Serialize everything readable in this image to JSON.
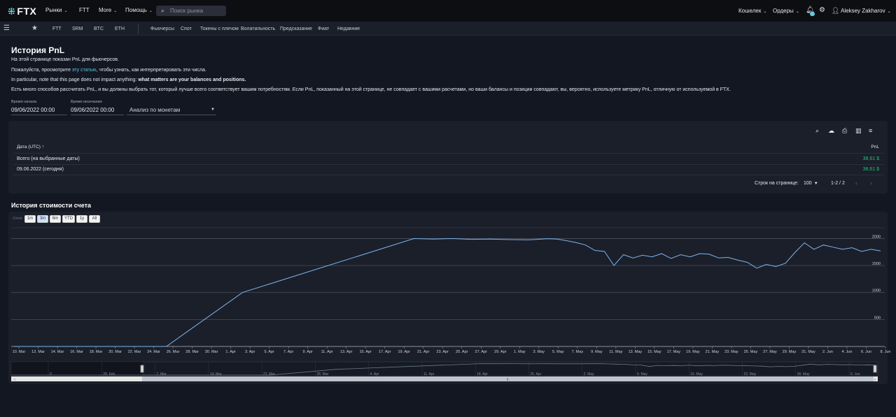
{
  "header": {
    "logo_text": "FTX",
    "nav": [
      {
        "label": "Рынки",
        "dropdown": true
      },
      {
        "label": "FTT",
        "dropdown": false
      },
      {
        "label": "More",
        "dropdown": true
      },
      {
        "label": "Помощь",
        "dropdown": true
      }
    ],
    "search_placeholder": "Поиск рынка",
    "wallet_label": "Кошелек",
    "orders_label": "Ордеры",
    "user_name": "Aleksey Zakharov"
  },
  "subnav": {
    "markets": [
      "FTT",
      "SRM",
      "BTC",
      "ETH"
    ],
    "sections": [
      "Фьючерсы",
      "Спот",
      "Токены с плечом",
      "Волатильность",
      "Предсказание",
      "Фиат",
      "Недавние"
    ]
  },
  "page": {
    "title": "История PnL",
    "line1": "На этой странице показан PnL для фьючерсов.",
    "line2_prefix": "Пожалуйста, просмотрите ",
    "line2_link": "эту статью",
    "line2_suffix": ", чтобы узнать, как интерпретировать эти числа.",
    "line3_prefix": "In particular, note that this page does not impact anything: ",
    "line3_bold": "what matters are your balances and positions.",
    "line4": "Есть много способов рассчитать PnL, и вы должны выбрать тот, который лучше всего соответствует вашим потребностям. Если PnL, показанный на этой странице, не совпадает с вашими расчетами, но ваши балансы и позиции совпадают, вы, вероятно, используете метрику PnL, отличную от используемой в FTX."
  },
  "filters": {
    "start_label": "Время начала",
    "start_value": "09/06/2022 00:00",
    "end_label": "Время окончания",
    "end_value": "09/06/2022 00:00",
    "analysis_value": "Анализ по монетам"
  },
  "table": {
    "col_date": "Дата (UTC)",
    "col_pnl": "PnL",
    "rows": [
      {
        "date": "Всего (на выбранные даты)",
        "pnl": "38,61 $"
      },
      {
        "date": "09.06.2022 (сегодня)",
        "pnl": "38,61 $"
      }
    ],
    "rows_per_page_label": "Строк на странице:",
    "rows_per_page_value": "100",
    "range": "1-2 / 2"
  },
  "chart_section": {
    "title": "История стоимости счета",
    "zoom_label": "Zoom",
    "zoom_buttons": [
      "1m",
      "3m",
      "6m",
      "YTD",
      "1y",
      "All"
    ],
    "zoom_active": "3m"
  },
  "chart_data": {
    "type": "line",
    "title": "",
    "xlabel": "",
    "ylabel": "",
    "ylim": [
      0,
      2200
    ],
    "y_ticks": [
      500,
      1000,
      1500,
      2000
    ],
    "x_ticks": [
      "10. Mar",
      "12. Mar",
      "14. Mar",
      "16. Mar",
      "18. Mar",
      "20. Mar",
      "22. Mar",
      "24. Mar",
      "26. Mar",
      "28. Mar",
      "30. Mar",
      "1. Apr",
      "3. Apr",
      "5. Apr",
      "7. Apr",
      "9. Apr",
      "11. Apr",
      "13. Apr",
      "15. Apr",
      "17. Apr",
      "19. Apr",
      "21. Apr",
      "23. Apr",
      "25. Apr",
      "27. Apr",
      "29. Apr",
      "1. May",
      "3. May",
      "5. May",
      "7. May",
      "9. May",
      "11. May",
      "13. May",
      "15. May",
      "17. May",
      "19. May",
      "21. May",
      "23. May",
      "25. May",
      "27. May",
      "29. May",
      "31. May",
      "2. Jun",
      "4. Jun",
      "6. Jun",
      "8. Jun"
    ],
    "x_start": "2022-03-10",
    "x_end": "2022-06-09",
    "series": [
      {
        "color": "#7cb5ec",
        "points": [
          [
            "2022-03-10",
            0
          ],
          [
            "2022-03-26",
            0
          ],
          [
            "2022-04-03",
            1000
          ],
          [
            "2022-04-21",
            2000
          ],
          [
            "2022-04-23",
            1990
          ],
          [
            "2022-04-25",
            2000
          ],
          [
            "2022-04-27",
            1985
          ],
          [
            "2022-04-29",
            1990
          ],
          [
            "2022-05-01",
            1980
          ],
          [
            "2022-05-03",
            1975
          ],
          [
            "2022-05-05",
            1995
          ],
          [
            "2022-05-06",
            1990
          ],
          [
            "2022-05-07",
            1960
          ],
          [
            "2022-05-08",
            1925
          ],
          [
            "2022-05-09",
            1880
          ],
          [
            "2022-05-10",
            1780
          ],
          [
            "2022-05-11",
            1760
          ],
          [
            "2022-05-12",
            1500
          ],
          [
            "2022-05-13",
            1700
          ],
          [
            "2022-05-14",
            1640
          ],
          [
            "2022-05-15",
            1690
          ],
          [
            "2022-05-16",
            1660
          ],
          [
            "2022-05-17",
            1720
          ],
          [
            "2022-05-18",
            1630
          ],
          [
            "2022-05-19",
            1700
          ],
          [
            "2022-05-20",
            1660
          ],
          [
            "2022-05-21",
            1720
          ],
          [
            "2022-05-22",
            1710
          ],
          [
            "2022-05-23",
            1640
          ],
          [
            "2022-05-24",
            1650
          ],
          [
            "2022-05-25",
            1600
          ],
          [
            "2022-05-26",
            1560
          ],
          [
            "2022-05-27",
            1450
          ],
          [
            "2022-05-28",
            1520
          ],
          [
            "2022-05-29",
            1480
          ],
          [
            "2022-05-30",
            1540
          ],
          [
            "2022-05-31",
            1740
          ],
          [
            "2022-06-01",
            1920
          ],
          [
            "2022-06-02",
            1800
          ],
          [
            "2022-06-03",
            1880
          ],
          [
            "2022-06-04",
            1840
          ],
          [
            "2022-06-05",
            1800
          ],
          [
            "2022-06-06",
            1830
          ],
          [
            "2022-06-07",
            1760
          ],
          [
            "2022-06-08",
            1800
          ],
          [
            "2022-06-09",
            1770
          ]
        ]
      }
    ],
    "navigator_ticks": [
      "0",
      "28. Feb",
      "7. Mar",
      "14. Mar",
      "21. Mar",
      "28. Mar",
      "4. Apr",
      "11. Apr",
      "18. Apr",
      "25. Apr",
      "2. May",
      "9. May",
      "16. May",
      "23. May",
      "30. May",
      "6. Jun"
    ]
  }
}
